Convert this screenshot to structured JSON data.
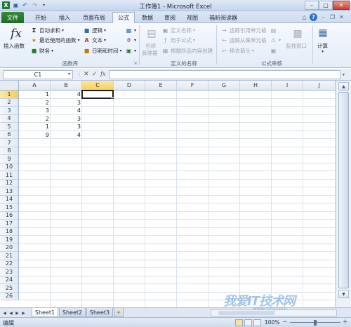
{
  "window": {
    "title": "工作簿1 - Microsoft Excel"
  },
  "qat": {
    "save_icon": "save-icon",
    "undo_icon": "undo-icon",
    "redo_icon": "redo-icon"
  },
  "tabs": [
    "文件",
    "开始",
    "插入",
    "页面布局",
    "公式",
    "数据",
    "审阅",
    "视图",
    "福昕阅读器"
  ],
  "active_tab": "公式",
  "ribbon": {
    "function_library": {
      "insert_function": "插入函数",
      "autosum": "自动求和",
      "recent": "最近使用的函数",
      "financial": "财务",
      "logical": "逻辑",
      "text": "文本",
      "datetime": "日期和时间",
      "label": "函数库"
    },
    "defined_names": {
      "name_manager_1": "名称",
      "name_manager_2": "管理器",
      "define_name": "定义名称",
      "use_in_formula": "用于公式",
      "create_from_selection": "根据所选内容创建",
      "label": "定义的名称"
    },
    "formula_auditing": {
      "trace_precedents": "追踪引用单元格",
      "trace_dependents": "追踪从属单元格",
      "remove_arrows": "移去箭头",
      "watch_window": "监视窗口",
      "label": "公式审核"
    },
    "calculation": {
      "calculate": "计算"
    }
  },
  "formula_bar": {
    "name_box": "C1",
    "fx": "fx",
    "formula": ""
  },
  "columns": [
    "A",
    "B",
    "C",
    "D",
    "E",
    "F",
    "G",
    "H",
    "I",
    "J"
  ],
  "rows": [
    "1",
    "2",
    "3",
    "4",
    "5",
    "6",
    "7",
    "8",
    "9",
    "10",
    "11",
    "12",
    "13",
    "14",
    "15",
    "16",
    "17",
    "18",
    "19",
    "20",
    "21",
    "22",
    "23",
    "24",
    "25",
    "26"
  ],
  "cells": {
    "A": [
      "1",
      "2",
      "3",
      "2",
      "1",
      "9"
    ],
    "B": [
      "4",
      "3",
      "4",
      "3",
      "3",
      "4"
    ]
  },
  "active_cell": "C1",
  "sheets": [
    "Sheet1",
    "Sheet2",
    "Sheet3"
  ],
  "active_sheet": "Sheet1",
  "status": {
    "mode": "编辑",
    "zoom": "100%"
  },
  "watermark": {
    "main": "我爱IT技术网",
    "sub": "www.52ij.com"
  }
}
